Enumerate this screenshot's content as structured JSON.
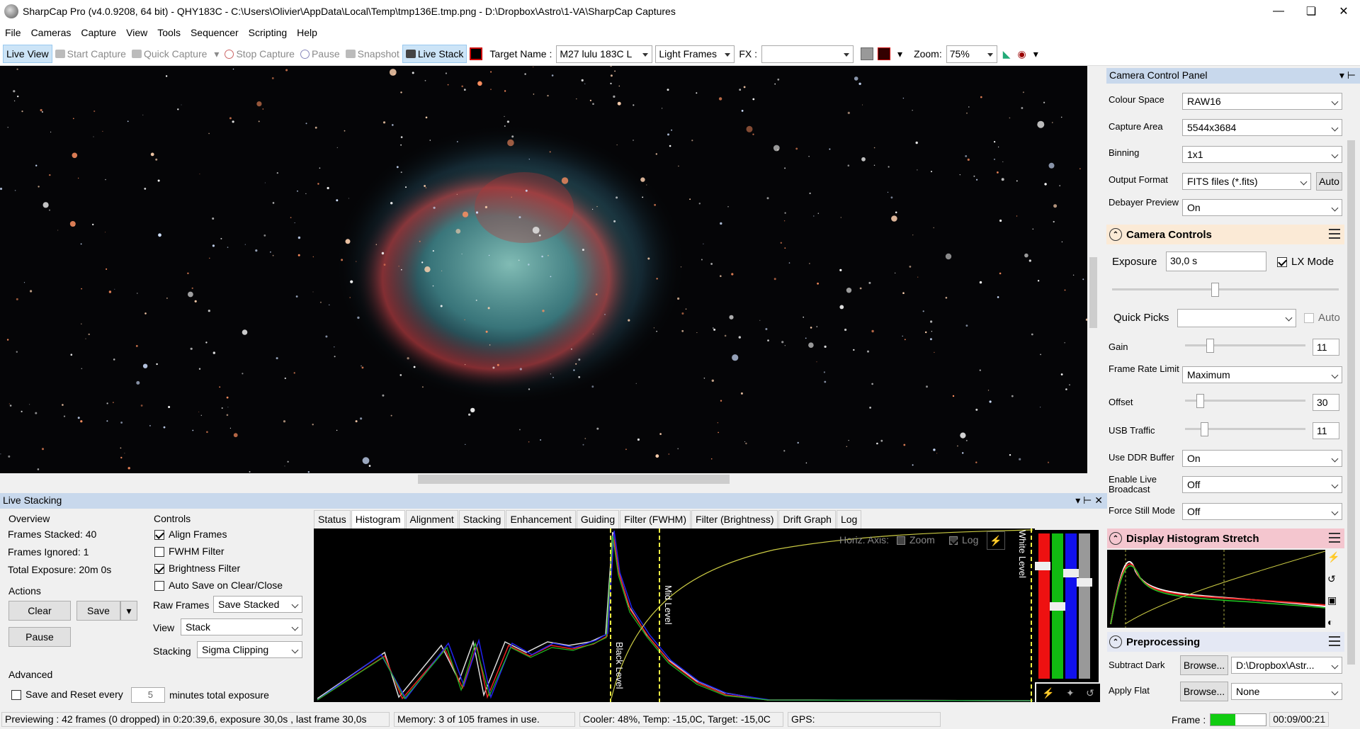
{
  "window": {
    "title": "SharpCap Pro (v4.0.9208, 64 bit) - QHY183C - C:\\Users\\Olivier\\AppData\\Local\\Temp\\tmp136E.tmp.png - D:\\Dropbox\\Astro\\1-VA\\SharpCap Captures"
  },
  "menu": [
    "File",
    "Cameras",
    "Capture",
    "View",
    "Tools",
    "Sequencer",
    "Scripting",
    "Help"
  ],
  "toolbar": {
    "live_view": "Live View",
    "start_capture": "Start Capture",
    "quick_capture": "Quick Capture",
    "stop_capture": "Stop Capture",
    "pause": "Pause",
    "snapshot": "Snapshot",
    "live_stack": "Live Stack",
    "target_label": "Target Name :",
    "target_value": "M27 lulu 183C L",
    "frame_type": "Light Frames",
    "fx_label": "FX :",
    "fx_value": "",
    "zoom_label": "Zoom:",
    "zoom_value": "75%"
  },
  "panel": {
    "title": "Camera Control Panel",
    "colour_space_label": "Colour Space",
    "colour_space": "RAW16",
    "capture_area_label": "Capture Area",
    "capture_area": "5544x3684",
    "binning_label": "Binning",
    "binning": "1x1",
    "output_format_label": "Output Format",
    "output_format": "FITS files (*.fits)",
    "auto_label": "Auto",
    "debayer_label": "Debayer Preview",
    "debayer": "On",
    "camera_controls": "Camera Controls",
    "exposure_label": "Exposure",
    "exposure": "30,0 s",
    "lx_mode": "LX Mode",
    "quick_picks_label": "Quick Picks",
    "quick_picks_auto": "Auto",
    "gain_label": "Gain",
    "gain": "11",
    "frame_rate_label": "Frame Rate Limit",
    "frame_rate": "Maximum",
    "offset_label": "Offset",
    "offset": "30",
    "usb_label": "USB Traffic",
    "usb": "11",
    "ddr_label": "Use DDR Buffer",
    "ddr": "On",
    "broadcast_label": "Enable Live Broadcast",
    "broadcast": "Off",
    "still_label": "Force Still Mode",
    "still": "Off",
    "histogram_stretch": "Display Histogram Stretch",
    "preprocessing": "Preprocessing",
    "dark_label": "Subtract Dark",
    "dark_browse": "Browse...",
    "dark_value": "D:\\Dropbox\\Astr...",
    "flat_label": "Apply Flat",
    "flat_browse": "Browse...",
    "flat_value": "None"
  },
  "live_stacking": {
    "title": "Live Stacking",
    "overview": "Overview",
    "frames_stacked": "Frames Stacked:  40",
    "frames_ignored": "Frames Ignored:  1",
    "total_exposure": "Total Exposure:   20m 0s",
    "actions": "Actions",
    "clear": "Clear",
    "save": "Save",
    "pause": "Pause",
    "advanced": "Advanced",
    "save_reset": "Save and Reset every",
    "save_reset_value": "5",
    "minutes": "minutes total exposure",
    "controls": "Controls",
    "align": "Align Frames",
    "fwhm": "FWHM Filter",
    "brightness": "Brightness Filter",
    "autosave": "Auto Save on Clear/Close",
    "raw_frames_label": "Raw Frames",
    "raw_frames": "Save Stacked",
    "view_label": "View",
    "view": "Stack",
    "stacking_label": "Stacking",
    "stacking": "Sigma Clipping",
    "tabs": [
      "Status",
      "Histogram",
      "Alignment",
      "Stacking",
      "Enhancement",
      "Guiding",
      "Filter (FWHM)",
      "Filter (Brightness)",
      "Drift Graph",
      "Log"
    ],
    "horiz_axis": "Horiz. Axis:",
    "zoom": "Zoom",
    "log": "Log",
    "black_level": "Black Level",
    "mid_level": "Mid Level",
    "white_level": "White Level"
  },
  "status": {
    "preview": "Previewing : 42 frames (0 dropped) in 0:20:39,6, exposure 30,0s , last frame 30,0s",
    "memory": "Memory: 3 of 105 frames in use.",
    "cooler": "Cooler: 48%, Temp: -15,0C, Target: -15,0C",
    "gps": "GPS:",
    "frame": "Frame :",
    "time": "00:09/00:21"
  }
}
